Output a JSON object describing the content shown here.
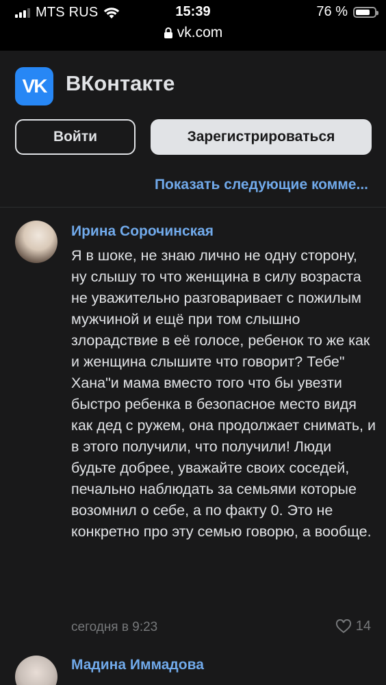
{
  "status": {
    "carrier": "MTS RUS",
    "time": "15:39",
    "battery_percent": "76 %",
    "battery_level": 0.76,
    "url": "vk.com"
  },
  "header": {
    "logo_text": "VK",
    "title": "ВКонтакте",
    "login_label": "Войти",
    "register_label": "Зарегистрироваться",
    "accent_color": "#2787f5"
  },
  "comments": {
    "show_more": "Показать следующие комме...",
    "items": [
      {
        "author": "Ирина Сорочинская",
        "text": "Я в шоке, не знаю лично не одну сторону, ну слышу то что женщина в силу возраста не уважительно разговаривает с пожилым мужчиной и ещё при том слышно злорадствие в её голосе, ребенок то же как и женщина слышите что говорит? Тебе\" Хана\"и мама вместо того что бы увезти быстро ребенка в безопасное место видя как дед с ружем, она продолжает снимать, и в этого получили, что получили! Люди будьте добрее, уважайте своих соседей, печально наблюдать за семьями которые возомнил о себе, а по факту 0. Это не конкретно про эту семью говорю, а вообще.",
        "time": "сегодня в 9:23",
        "likes": "14"
      },
      {
        "author": "Мадина Иммадова"
      }
    ]
  }
}
